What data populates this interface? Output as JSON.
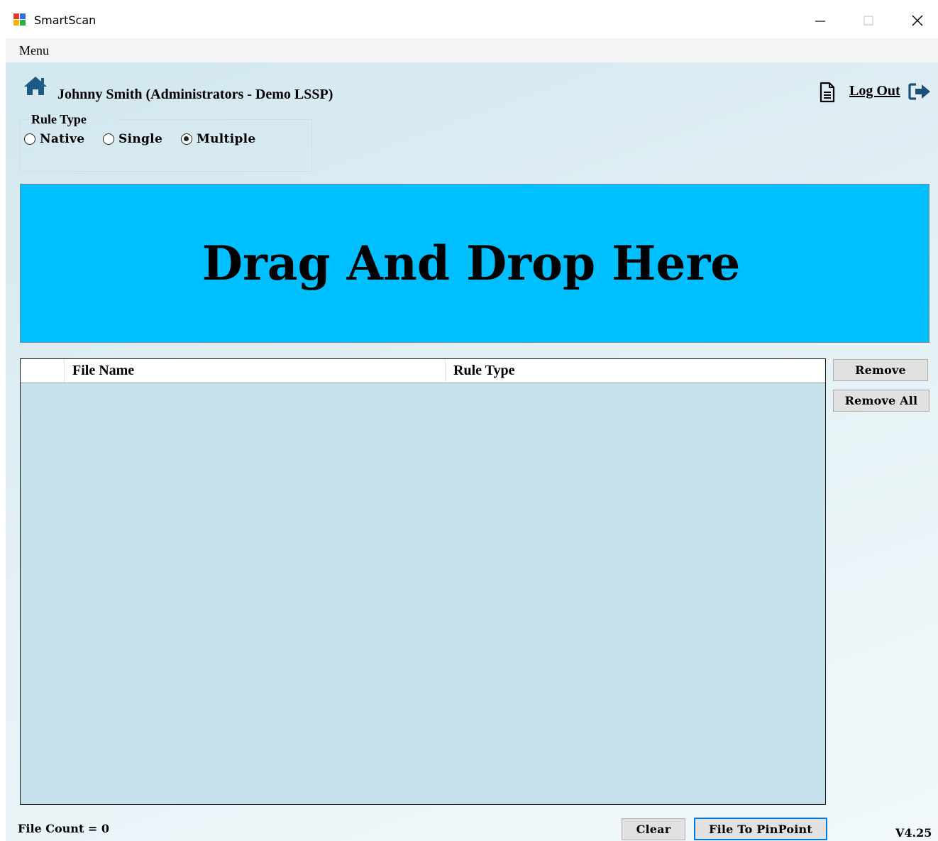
{
  "window": {
    "title": "SmartScan",
    "controls": {
      "minimize": "minimize-icon",
      "maximize": "maximize-icon",
      "close": "close-icon"
    }
  },
  "menubar": {
    "items": [
      {
        "label": "Menu"
      }
    ]
  },
  "header": {
    "home_icon": "home-icon",
    "user": "Johnny Smith (Administrators - Demo LSSP)",
    "document_icon": "document-icon",
    "logout_label": "Log Out",
    "logout_icon": "sign-out-icon"
  },
  "rule_type": {
    "legend": "Rule Type",
    "options": [
      {
        "label": "Native",
        "checked": false
      },
      {
        "label": "Single",
        "checked": false
      },
      {
        "label": "Multiple",
        "checked": true
      }
    ]
  },
  "dropzone": {
    "text": "Drag And Drop Here",
    "background": "#00bfff"
  },
  "grid": {
    "columns": [
      "",
      "File Name",
      "Rule Type"
    ],
    "rows": []
  },
  "side_buttons": {
    "remove": "Remove",
    "remove_all": "Remove All"
  },
  "footer": {
    "file_count": "File Count = 0",
    "clear": "Clear",
    "file_to_pinpoint": "File To PinPoint",
    "version": "V4.25"
  },
  "colors": {
    "accent_focus": "#0078d7",
    "home_icon": "#1d5a8a",
    "grid_body": "#c4e1ec"
  }
}
